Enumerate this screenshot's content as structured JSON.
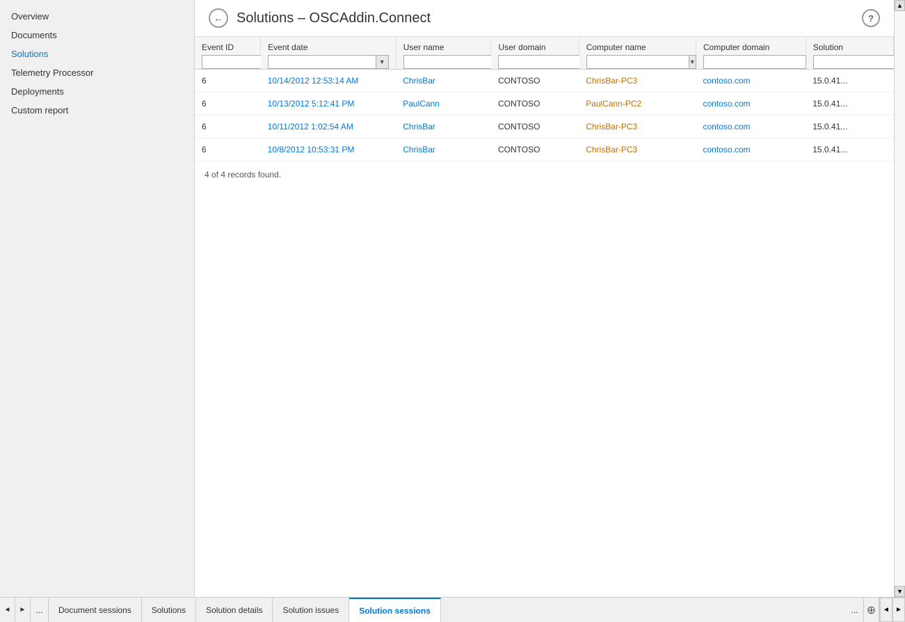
{
  "sidebar": {
    "items": [
      {
        "id": "overview",
        "label": "Overview",
        "active": false
      },
      {
        "id": "documents",
        "label": "Documents",
        "active": false
      },
      {
        "id": "solutions",
        "label": "Solutions",
        "active": true
      },
      {
        "id": "telemetry",
        "label": "Telemetry Processor",
        "active": false
      },
      {
        "id": "deployments",
        "label": "Deployments",
        "active": false
      },
      {
        "id": "custom-report",
        "label": "Custom report",
        "active": false
      }
    ]
  },
  "header": {
    "title": "Solutions – OSCAddin.Connect",
    "back_label": "←",
    "help_label": "?"
  },
  "table": {
    "columns": [
      {
        "id": "event-id",
        "label": "Event ID",
        "class": "col-eventid"
      },
      {
        "id": "event-date",
        "label": "Event date",
        "class": "col-eventdate"
      },
      {
        "id": "user-name",
        "label": "User name",
        "class": "col-username"
      },
      {
        "id": "user-domain",
        "label": "User domain",
        "class": "col-userdomain"
      },
      {
        "id": "computer-name",
        "label": "Computer name",
        "class": "col-computername"
      },
      {
        "id": "computer-domain",
        "label": "Computer domain",
        "class": "col-computerdomain"
      },
      {
        "id": "solution",
        "label": "Solution",
        "class": "col-solution"
      }
    ],
    "rows": [
      {
        "event_id": "6",
        "event_date": "10/14/2012 12:53:14 AM",
        "user_name": "ChrisBar",
        "user_domain": "CONTOSO",
        "computer_name": "ChrisBar-PC3",
        "computer_domain": "contoso.com",
        "solution": "15.0.41..."
      },
      {
        "event_id": "6",
        "event_date": "10/13/2012 5:12:41 PM",
        "user_name": "PaulCann",
        "user_domain": "CONTOSO",
        "computer_name": "PaulCann-PC2",
        "computer_domain": "contoso.com",
        "solution": "15.0.41..."
      },
      {
        "event_id": "6",
        "event_date": "10/11/2012 1:02:54 AM",
        "user_name": "ChrisBar",
        "user_domain": "CONTOSO",
        "computer_name": "ChrisBar-PC3",
        "computer_domain": "contoso.com",
        "solution": "15.0.41..."
      },
      {
        "event_id": "6",
        "event_date": "10/8/2012 10:53:31 PM",
        "user_name": "ChrisBar",
        "user_domain": "CONTOSO",
        "computer_name": "ChrisBar-PC3",
        "computer_domain": "contoso.com",
        "solution": "15.0.41..."
      }
    ],
    "records_found": "4 of 4 records found."
  },
  "bottom_tabs": {
    "tabs": [
      {
        "id": "document-sessions",
        "label": "Document sessions",
        "active": false
      },
      {
        "id": "solutions",
        "label": "Solutions",
        "active": false
      },
      {
        "id": "solution-details",
        "label": "Solution details",
        "active": false
      },
      {
        "id": "solution-issues",
        "label": "Solution issues",
        "active": false
      },
      {
        "id": "solution-sessions",
        "label": "Solution sessions",
        "active": true
      }
    ],
    "ellipsis_label": "...",
    "add_label": "+",
    "nav_prev": "◄",
    "nav_next": "►"
  },
  "colors": {
    "link_blue": "#0078d7",
    "link_orange": "#c07000",
    "active_tab_blue": "#0078d7",
    "sidebar_active": "#0078d7"
  }
}
